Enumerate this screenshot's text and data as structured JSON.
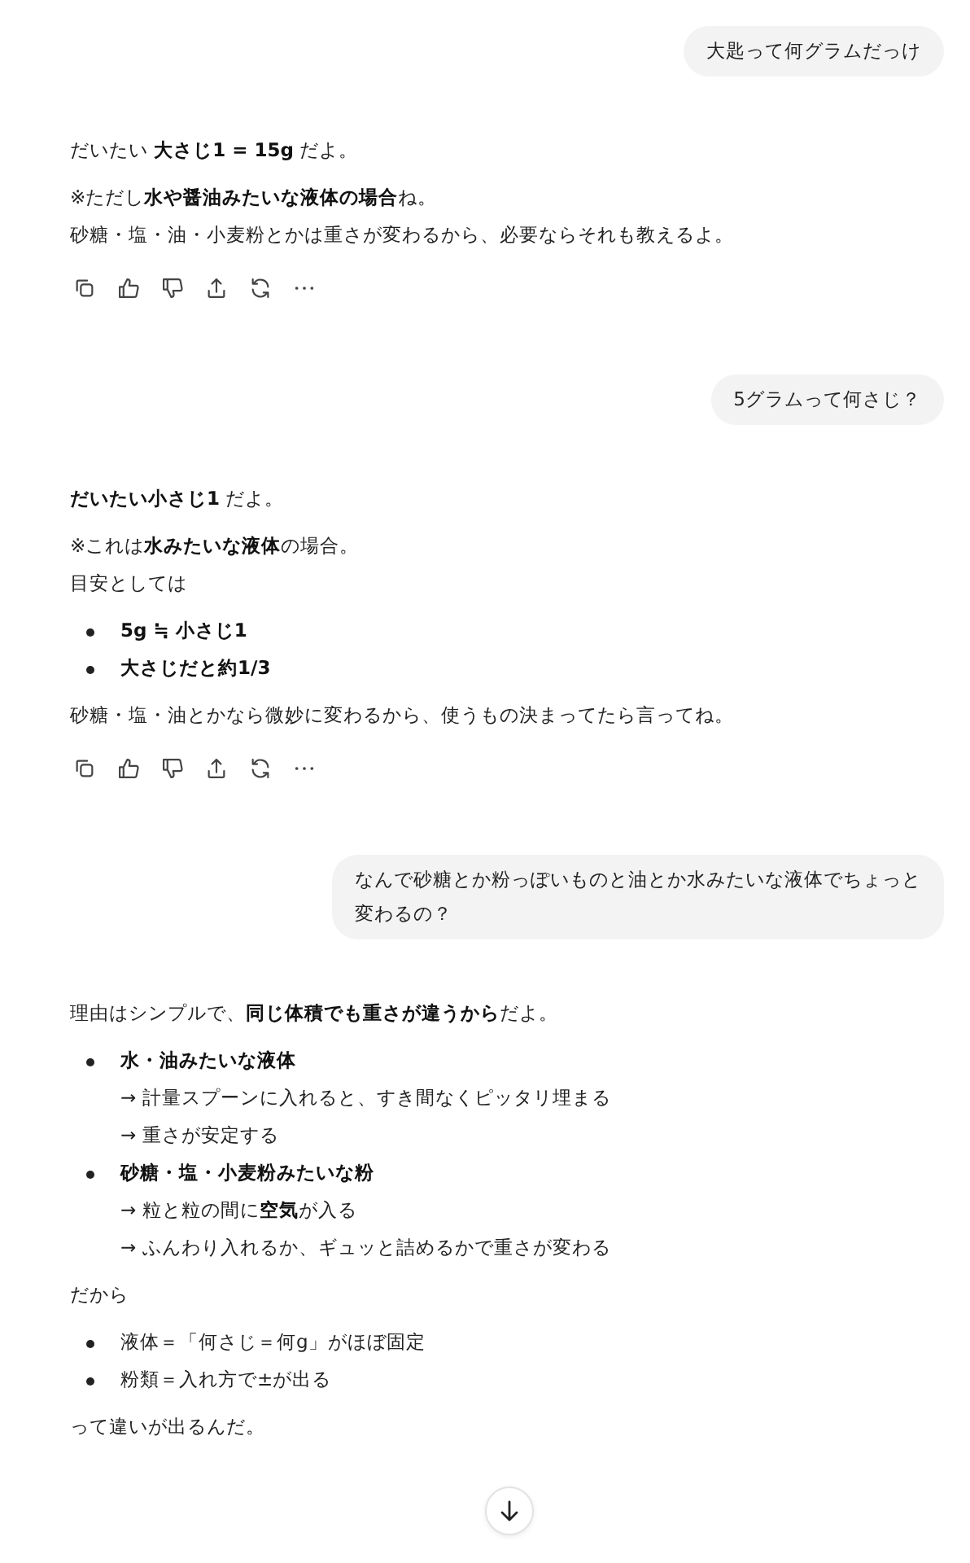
{
  "messages": [
    {
      "kind": "user",
      "text": "大匙って何グラムだっけ"
    },
    {
      "kind": "assistant",
      "actions": true,
      "blocks": [
        {
          "kind": "para",
          "lines": [
            "だいたい **大さじ1 = 15g** だよ。"
          ]
        },
        {
          "kind": "para",
          "lines": [
            "※ただし**水や醤油みたいな液体の場合**ね。",
            "砂糖・塩・油・小麦粉とかは重さが変わるから、必要ならそれも教えるよ。"
          ]
        }
      ]
    },
    {
      "kind": "user",
      "text": "5グラムって何さじ？"
    },
    {
      "kind": "assistant",
      "actions": true,
      "blocks": [
        {
          "kind": "para",
          "lines": [
            "**だいたい小さじ1** だよ。"
          ]
        },
        {
          "kind": "para",
          "lines": [
            "※これは**水みたいな液体**の場合。",
            "目安としては"
          ]
        },
        {
          "kind": "list",
          "items": [
            {
              "text": "5g ≒ 小さじ1",
              "bold": true
            },
            {
              "text": "大さじだと約1/3",
              "bold": true
            }
          ]
        },
        {
          "kind": "para",
          "lines": [
            "砂糖・塩・油とかなら微妙に変わるから、使うもの決まってたら言ってね。"
          ]
        }
      ]
    },
    {
      "kind": "user",
      "text": "なんで砂糖とか粉っぽいものと油とか水みたいな液体でちょっと変わるの？"
    },
    {
      "kind": "assistant",
      "actions": false,
      "blocks": [
        {
          "kind": "para",
          "lines": [
            "理由はシンプルで、**同じ体積でも重さが違うから**だよ。"
          ]
        },
        {
          "kind": "list",
          "items": [
            {
              "text": "水・油みたいな液体",
              "bold": true,
              "lines": [
                "→ 計量スプーンに入れると、すき間なくピッタリ埋まる",
                "→ 重さが安定する"
              ]
            },
            {
              "text": "砂糖・塩・小麦粉みたいな粉",
              "bold": true,
              "lines": [
                "→ 粒と粒の間に**空気**が入る",
                "→ ふんわり入れるか、ギュッと詰めるかで重さが変わる"
              ]
            }
          ]
        },
        {
          "kind": "para",
          "lines": [
            "だから"
          ]
        },
        {
          "kind": "list",
          "items": [
            {
              "text": "液体＝「何さじ＝何g」がほぼ固定",
              "bold": false
            },
            {
              "text": "粉類＝入れ方で±が出る",
              "bold": false
            }
          ]
        },
        {
          "kind": "para",
          "lines": [
            "って違いが出るんだ。"
          ]
        }
      ]
    }
  ],
  "scroll_button": true
}
